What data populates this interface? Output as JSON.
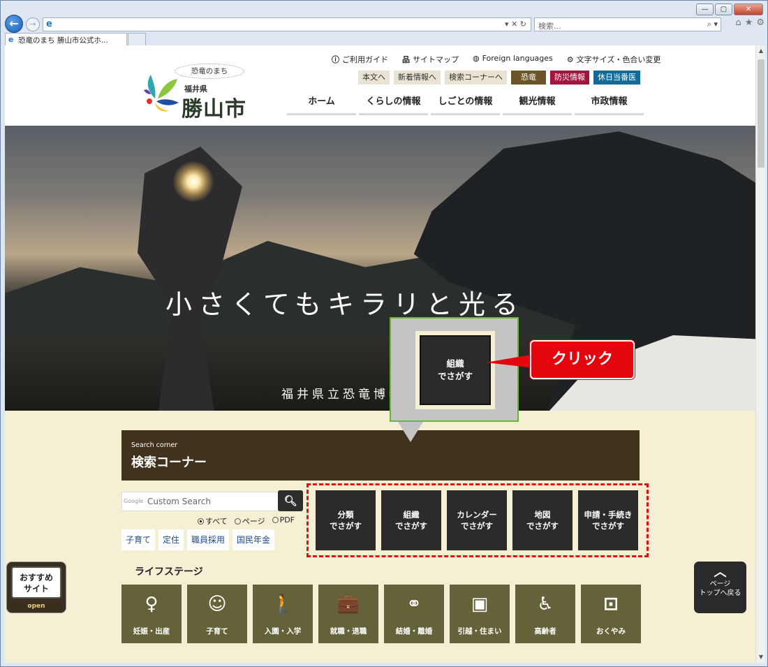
{
  "browser": {
    "address_url": "",
    "search_placeholder": "検索...",
    "tab_title": "恐竜のまち 勝山市公式ホ..."
  },
  "site": {
    "logo": {
      "bubble": "恐竜のまち",
      "prefecture": "福井県",
      "city": "勝山市"
    },
    "util_nav": [
      {
        "icon": "guide-icon",
        "label": "ご利用ガイド"
      },
      {
        "icon": "sitemap-icon",
        "label": "サイトマップ"
      },
      {
        "icon": "globe-icon",
        "label": "Foreign languages"
      },
      {
        "icon": "text-size-icon",
        "label": "文字サイズ・色合い変更"
      }
    ],
    "sub_nav": [
      "本文へ",
      "新着情報へ",
      "検索コーナーへ",
      "恐竜",
      "防災情報",
      "休日当番医"
    ],
    "main_nav": [
      "ホーム",
      "くらしの情報",
      "しごとの情報",
      "観光情報",
      "市政情報"
    ]
  },
  "hero": {
    "title": "小さくてもキラリと光る",
    "caption": "福井県立恐竜博物"
  },
  "search_corner": {
    "subtitle": "Search corner",
    "title": "検索コーナー",
    "google_brand": "Google",
    "placeholder": "Custom Search",
    "radios": [
      {
        "label": "すべて",
        "checked": true
      },
      {
        "label": "ページ",
        "checked": false
      },
      {
        "label": "PDF",
        "checked": false
      }
    ],
    "quick_tags": [
      "子育て",
      "定住",
      "職員採用",
      "国民年金"
    ],
    "finders": [
      "分類\nでさがす",
      "組織\nでさがす",
      "カレンダー\nでさがす",
      "地図\nでさがす",
      "申請・手続き\nでさがす"
    ]
  },
  "life_stage": {
    "title": "ライフステージ",
    "items": [
      {
        "label": "妊娠・出産",
        "icon": "pregnancy-icon",
        "glyph": "♀"
      },
      {
        "label": "子育て",
        "icon": "child-icon",
        "glyph": "☺"
      },
      {
        "label": "入園・入学",
        "icon": "school-icon",
        "glyph": "🚶"
      },
      {
        "label": "就職・退職",
        "icon": "work-icon",
        "glyph": "💼"
      },
      {
        "label": "結婚・離婚",
        "icon": "marriage-icon",
        "glyph": "⚭"
      },
      {
        "label": "引越・住まい",
        "icon": "moving-icon",
        "glyph": "▣"
      },
      {
        "label": "高齢者",
        "icon": "elderly-icon",
        "glyph": "♿"
      },
      {
        "label": "おくやみ",
        "icon": "condolence-icon",
        "glyph": "⊡"
      }
    ]
  },
  "floating": {
    "osusume": "おすすめ\nサイト",
    "osusume_open": "open",
    "pagetop": "ページ\nトップへ戻る"
  },
  "annotation": {
    "zoom_button": "組織\nでさがす",
    "click_label": "クリック"
  },
  "colors": {
    "accent_red": "#e3060e",
    "callout_border": "#6ab536",
    "search_header": "#40321c",
    "life_stage_bg": "#646238",
    "content_bg": "#f5efd4"
  }
}
